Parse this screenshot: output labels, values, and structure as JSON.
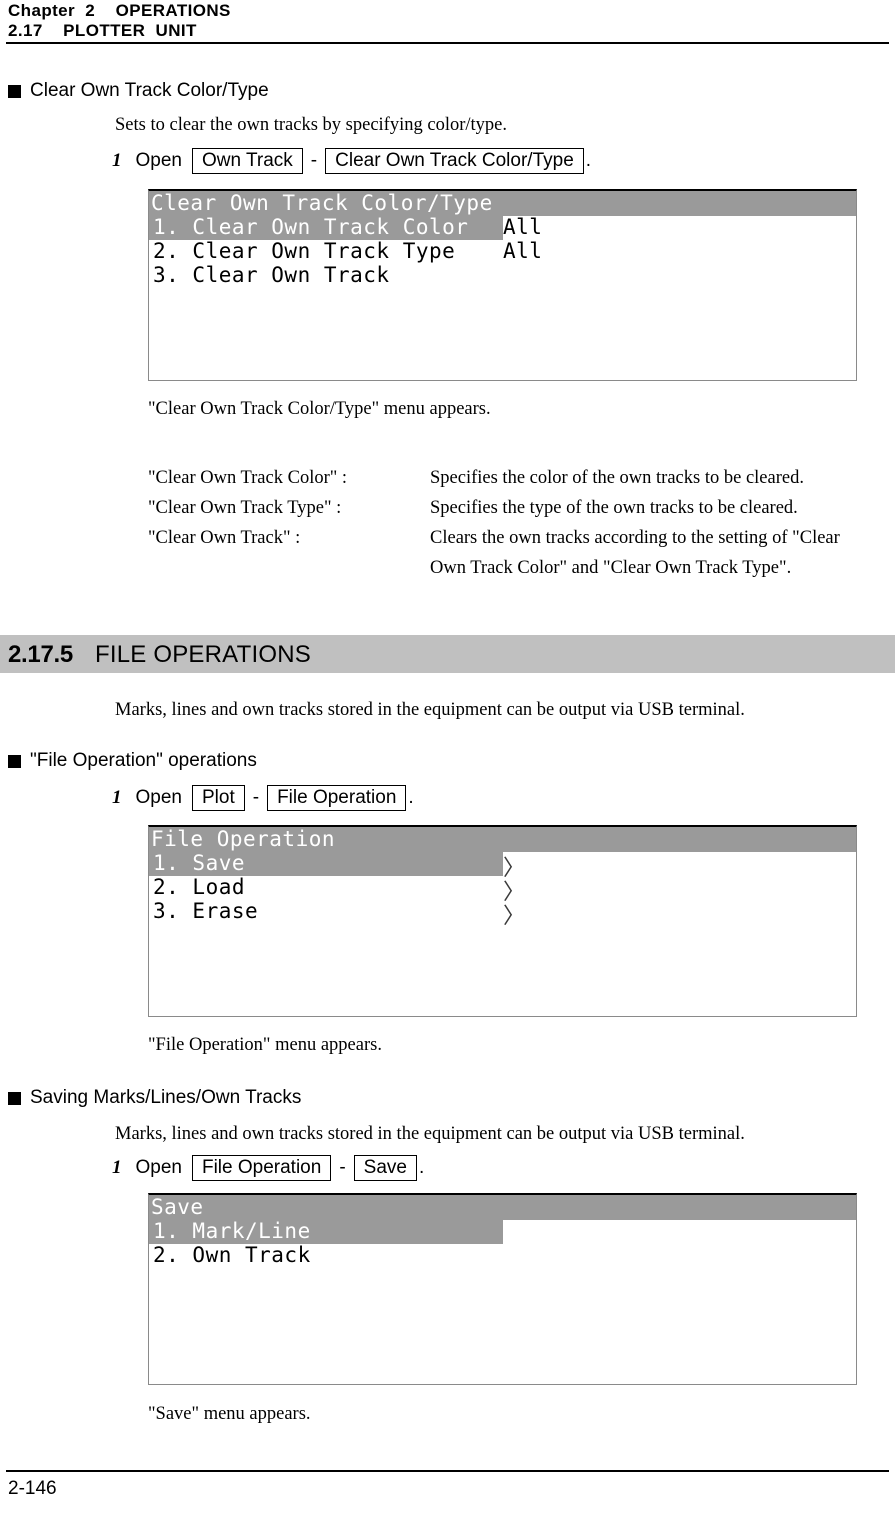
{
  "header": {
    "line1": "Chapter  2    OPERATIONS",
    "line2": "2.17    PLOTTER  UNIT"
  },
  "sections": {
    "clear_own_track": {
      "heading": "Clear Own Track Color/Type",
      "intro": "Sets to clear the own tracks by specifying color/type.",
      "step": {
        "number": "1",
        "open_label": "Open",
        "key1": "Own Track",
        "separator": "-",
        "key2": "Clear Own Track Color/Type",
        "period": "."
      },
      "menu": {
        "title": "Clear Own Track Color/Type",
        "rows": [
          {
            "label": "1. Clear Own Track Color",
            "value": "All",
            "selected": true
          },
          {
            "label": "2. Clear Own Track Type",
            "value": "All",
            "selected": false
          },
          {
            "label": "3. Clear Own Track",
            "value": "",
            "selected": false
          }
        ]
      },
      "caption": "\"Clear Own Track Color/Type\" menu appears.",
      "descriptions": [
        {
          "term": "\"Clear Own Track Color\" :",
          "definition": "Specifies the color of the own tracks to be cleared."
        },
        {
          "term": "\"Clear Own Track Type\" :",
          "definition": "Specifies the type of the own tracks to be cleared."
        },
        {
          "term": "\"Clear Own Track\" :",
          "definition": "Clears the own tracks according to the setting of \"Clear",
          "continuation": "Own Track Color\" and \"Clear Own Track Type\"."
        }
      ]
    },
    "file_operations": {
      "number": "2.17.5",
      "title": "FILE OPERATIONS",
      "intro": "Marks, lines and own tracks stored in the equipment can be output via USB terminal."
    },
    "file_operation_ops": {
      "heading": "\"File Operation\" operations",
      "step": {
        "number": "1",
        "open_label": "Open",
        "key1": "Plot",
        "separator": "-",
        "key2": "File Operation",
        "period": "."
      },
      "menu": {
        "title": "File Operation",
        "rows": [
          {
            "label": "1. Save",
            "chevron": "〉",
            "selected": true
          },
          {
            "label": "2. Load",
            "chevron": "〉",
            "selected": false
          },
          {
            "label": "3. Erase",
            "chevron": "〉",
            "selected": false
          }
        ]
      },
      "caption": "\"File Operation\" menu appears."
    },
    "saving_marks": {
      "heading": "Saving Marks/Lines/Own Tracks",
      "intro": "Marks, lines and own tracks stored in the equipment can be output via USB terminal.",
      "step": {
        "number": "1",
        "open_label": "Open",
        "key1": "File Operation",
        "separator": "-",
        "key2": "Save",
        "period": "."
      },
      "menu": {
        "title": "Save",
        "rows": [
          {
            "label": "1. Mark/Line",
            "value": "",
            "selected": true
          },
          {
            "label": "2. Own Track",
            "value": "",
            "selected": false
          }
        ]
      },
      "caption": "\"Save\" menu appears."
    }
  },
  "footer": {
    "page_number": "2-146"
  },
  "colors": {
    "menu_highlight": "#9a9a9a",
    "section_band": "#c0c0c0",
    "menu_border": "#8a8a8a"
  }
}
